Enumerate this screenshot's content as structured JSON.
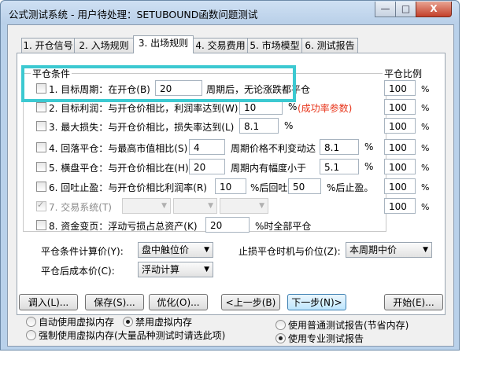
{
  "window": {
    "title": "公式测试系统 - 用户待处理：SETUBOUND函数问题测试",
    "controls": {
      "minimize": "—",
      "maximize": "□",
      "close": "X"
    }
  },
  "tabs": [
    {
      "label": "1. 开仓信号"
    },
    {
      "label": "2. 入场规则"
    },
    {
      "label": "3. 出场规则",
      "active": true
    },
    {
      "label": "4. 交易费用"
    },
    {
      "label": "5. 市场模型"
    },
    {
      "label": "6. 测试报告"
    }
  ],
  "conditions": {
    "group_label": "平仓条件",
    "ratio_label": "平仓比例",
    "percent_symbol": "%",
    "rows": [
      {
        "checked": false,
        "text1": "1. 目标周期：在开仓(B)",
        "value1": "20",
        "text2": "周期后，无论涨跌都平仓",
        "ratio": "100"
      },
      {
        "checked": false,
        "text1": "2. 目标利润：与开仓价相比，利润率达到(W)",
        "value1": "10",
        "pct": "%",
        "note": "(成功率参数)",
        "ratio": "100"
      },
      {
        "checked": false,
        "text1": "3. 最大损失：与开仓价相比，损失率达到(L)",
        "value1": "8.1",
        "pct": "%",
        "ratio": "100"
      },
      {
        "checked": false,
        "text1": "4. 回落平仓：与最高市值相比(S)",
        "value1": "4",
        "text2": "周期价格不利变动达",
        "value2": "8.1",
        "pct": "%",
        "ratio": "100"
      },
      {
        "checked": false,
        "text1": "5. 横盘平仓：与开仓价相比在(H)",
        "value1": "20",
        "text2": "周期内有幅度小于",
        "value2": "5.1",
        "pct": "%",
        "ratio": "100"
      },
      {
        "checked": false,
        "text1": "6. 回吐止盈：与开仓价相比利润率(R)",
        "value1": "10",
        "text2": "%后回吐",
        "value2": "50",
        "text3": "%后止盈。",
        "ratio": "100"
      },
      {
        "checked": true,
        "disabled": true,
        "text1": "7. 交易系统(T)",
        "ratio": "100"
      },
      {
        "checked": false,
        "text1": "8. 资金变页：浮动亏损占总资产(K)",
        "value1": "20",
        "text2": "%时全部平仓"
      }
    ]
  },
  "settings": {
    "calc_price_label": "平仓条件计算价(Y):",
    "calc_price_value": "盘中触位价",
    "stop_timing_label": "止损平仓时机与价位(Z):",
    "stop_timing_value": "本周期中价",
    "cost_label": "平仓后成本价(C):",
    "cost_value": "浮动计算"
  },
  "buttons": {
    "import": "调入(L)...",
    "save": "保存(S)...",
    "optimize": "优化(O)...",
    "prev": "<上一步(B)",
    "next": "下一步(N)>",
    "start": "开始(E)..."
  },
  "memory_options": [
    {
      "label": "自动使用虚拟内存",
      "selected": false
    },
    {
      "label": "禁用虚拟内存",
      "selected": true
    },
    {
      "label": "强制使用虚拟内存(大量品种测试时请选此项)",
      "selected": false
    }
  ],
  "report_options": [
    {
      "label": "使用普通测试报告(节省内存)",
      "selected": false
    },
    {
      "label": "使用专业测试报告",
      "selected": true
    }
  ],
  "colors": {
    "highlight": "#3cc9d1",
    "note_red": "#e8361c",
    "title_bg": "#b9d1ea"
  }
}
